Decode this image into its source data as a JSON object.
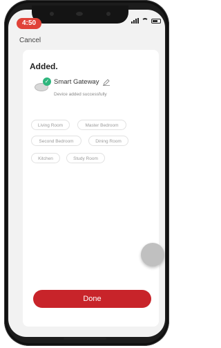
{
  "status_bar": {
    "time": "4:50",
    "icons": [
      "signal-icon",
      "wifi-icon",
      "battery-icon"
    ]
  },
  "header": {
    "cancel_label": "Cancel"
  },
  "main": {
    "title": "Added.",
    "device": {
      "name": "Smart Gateway",
      "status": "Device added successfully",
      "icons": [
        "device-image-icon",
        "check-icon",
        "edit-pencil-icon"
      ]
    },
    "rooms": [
      {
        "label": "Living Room"
      },
      {
        "label": "Master Bedroom"
      },
      {
        "label": "Second Bedroom"
      },
      {
        "label": "Dining Room"
      },
      {
        "label": "Kitchen"
      },
      {
        "label": "Study Room"
      }
    ],
    "done_label": "Done"
  },
  "colors": {
    "accent": "#c8242a",
    "success": "#2eb67d",
    "status_time_bg": "#e04238"
  }
}
